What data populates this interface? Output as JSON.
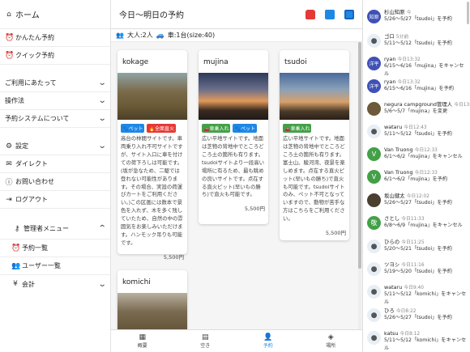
{
  "sidebar": {
    "home": "ホーム",
    "items": [
      {
        "label": "かんたん予約",
        "icon": "alarm-icon"
      },
      {
        "label": "クイック予約",
        "icon": "alarm-icon"
      },
      {
        "label": "ご利用にあたって",
        "chevron": true
      },
      {
        "label": "操作法",
        "chevron": true
      },
      {
        "label": "予約システムについて",
        "chevron": true
      },
      {
        "label": "設定",
        "icon": "gear-icon",
        "chevron": true
      },
      {
        "label": "ダイレクト",
        "icon": "envelope-icon"
      },
      {
        "label": "お問い合わせ",
        "icon": "info-icon"
      },
      {
        "label": "ログアウト",
        "icon": "logout-icon"
      }
    ],
    "admin": {
      "label": "管理者メニュー",
      "items": [
        {
          "label": "予約一覧"
        },
        {
          "label": "ユーザー一覧"
        },
        {
          "label": "会計"
        }
      ]
    }
  },
  "main": {
    "title": "今日〜明日の予約",
    "summary_people": "大人:2人",
    "summary_cars": "車:1台(size:40)",
    "cards": [
      {
        "name": "kokage",
        "tags": [
          {
            "label": "🐾ペット",
            "color": "blue"
          },
          {
            "label": "🔥全面直火",
            "color": "red"
          }
        ],
        "desc": "高台の林間サイトです。車両乗り入れ不可サイトですが、サイト入口に車を付けての荷下ろしは可能です。(坂が急なため、二駆では登れない可能性があります。その場合、実設の荷運びカートをご利用ください。)この区画には数本で景色を入れず、木を多く残していたため、自然の中の雰囲気をお楽しみいただけます。ハンモック吊りも可能です。",
        "price": "5,500円"
      },
      {
        "name": "mujina",
        "tags": [
          {
            "label": "🚗車乗入れ",
            "color": "green"
          },
          {
            "label": "🐾ペット",
            "color": "blue"
          }
        ],
        "desc": "広い平地サイトです。地面は芝物の背地中でところどころ土の箇所も有ります。tsudoiサイトより一段高い場所に有るため、最も眺めの良いサイトです。点在する直火ピット(早いもの勝ち)で直火も可能です。",
        "price": "5,500円"
      },
      {
        "name": "tsudoi",
        "tags": [
          {
            "label": "🚗車乗入れ",
            "color": "green"
          }
        ],
        "desc": "広い平地サイトです。地面は芝物の背地中でところどころ土の箇所も有ります。富士山、駿河湾、夜景を楽しめます。点在する直火ピット(早いもの勝ち)で直火も可能です。tsudoiサイトのみ、ペット不可となっていますので、動物が苦手な方はこちらをご利用ください。",
        "price": "5,500円"
      },
      {
        "name": "komichi",
        "tags": [],
        "desc": "",
        "price": ""
      }
    ]
  },
  "bottom_nav": [
    {
      "label": "概要",
      "icon": "store-icon"
    },
    {
      "label": "空き",
      "icon": "calendar-icon"
    },
    {
      "label": "予約",
      "icon": "user-icon"
    },
    {
      "label": "場所",
      "icon": "location-icon"
    }
  ],
  "feed": [
    {
      "avatar": "知原",
      "avatar_style": "blue",
      "name": "杉山知原",
      "time": "今",
      "text": "5/26〜5/27「tsudoi」を予約"
    },
    {
      "avatar": "",
      "avatar_style": "person",
      "name": "ゴロ",
      "time": "5分前",
      "text": "5/11〜5/12「tsudoi」を予約"
    },
    {
      "avatar": "洋平",
      "avatar_style": "blue",
      "name": "ryan",
      "time": "今日13:32",
      "text": "6/15〜6/16「mujina」をキャンセル"
    },
    {
      "avatar": "洋平",
      "avatar_style": "blue",
      "name": "ryan",
      "time": "今日13:32",
      "text": "6/15〜6/16「mujina」を予約"
    },
    {
      "avatar": "",
      "avatar_style": "logo",
      "name": "negura campground管理人",
      "time": "今日13:01",
      "text": "5/6〜5/7「mujina」を変更"
    },
    {
      "avatar": "",
      "avatar_style": "person",
      "name": "wataru",
      "time": "今日12:43",
      "text": "5/11〜5/12「tsudoi」を予約"
    },
    {
      "avatar": "V",
      "avatar_style": "green",
      "name": "Van Truong",
      "time": "今日12:33",
      "text": "6/1〜6/2「mujina」をキャンセル"
    },
    {
      "avatar": "V",
      "avatar_style": "green",
      "name": "Van Truong",
      "time": "今日12:33",
      "text": "6/1〜6/2「mujina」を予約"
    },
    {
      "avatar": "",
      "avatar_style": "dark",
      "name": "坂山健太",
      "time": "今日12:02",
      "text": "5/26〜5/27「tsudoi」を予約"
    },
    {
      "avatar": "敬",
      "avatar_style": "green",
      "name": "さとし",
      "time": "今日11:33",
      "text": "6/8〜6/9「mujina」をキャンセル"
    },
    {
      "avatar": "",
      "avatar_style": "person",
      "name": "ひらの",
      "time": "今日11:25",
      "text": "5/20〜5/21「tsudoi」を予約"
    },
    {
      "avatar": "",
      "avatar_style": "person",
      "name": "ツヨシ",
      "time": "今日11:16",
      "text": "5/19〜5/20「tsudoi」を予約"
    },
    {
      "avatar": "",
      "avatar_style": "person",
      "name": "wataru",
      "time": "今日9:40",
      "text": "5/11〜5/12「komichi」をキャンセル"
    },
    {
      "avatar": "",
      "avatar_style": "person",
      "name": "ひろ",
      "time": "今日8:22",
      "text": "5/26〜5/27「tsudoi」を予約"
    },
    {
      "avatar": "",
      "avatar_style": "person",
      "name": "katsu",
      "time": "今日8:12",
      "text": "5/11〜5/12「komichi」をキャンセル"
    }
  ]
}
